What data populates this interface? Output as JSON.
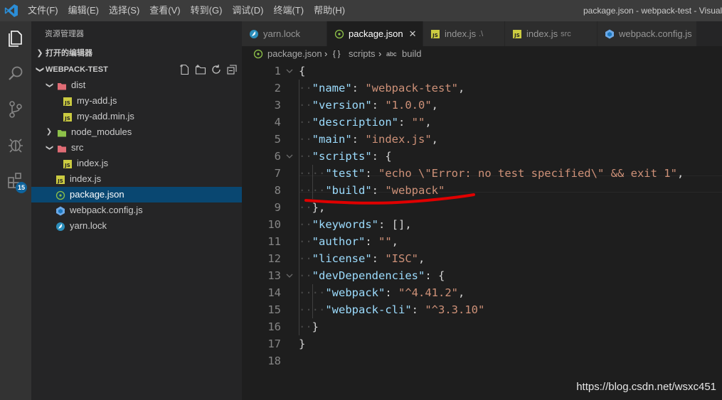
{
  "window": {
    "title": "package.json - webpack-test - Visual Studio Code",
    "menu": [
      "文件(F)",
      "编辑(E)",
      "选择(S)",
      "查看(V)",
      "转到(G)",
      "调试(D)",
      "终端(T)",
      "帮助(H)"
    ]
  },
  "activity_bar": {
    "items": [
      "files-icon",
      "search-icon",
      "source-control-icon",
      "debug-icon",
      "extensions-icon"
    ],
    "extensions_badge": "15",
    "accent": "#0e639c"
  },
  "explorer": {
    "title": "资源管理器",
    "open_editors_label": "打开的编辑器",
    "project_label": "WEBPACK-TEST",
    "tree": [
      {
        "name": "dist",
        "type": "folder",
        "expanded": true,
        "depth": 1
      },
      {
        "name": "my-add.js",
        "type": "js",
        "depth": 2
      },
      {
        "name": "my-add.min.js",
        "type": "js",
        "depth": 2
      },
      {
        "name": "node_modules",
        "type": "folder",
        "expanded": false,
        "depth": 1
      },
      {
        "name": "src",
        "type": "folder",
        "expanded": true,
        "depth": 1
      },
      {
        "name": "index.js",
        "type": "js",
        "depth": 2
      },
      {
        "name": "index.js",
        "type": "js",
        "depth": 1
      },
      {
        "name": "package.json",
        "type": "json",
        "depth": 1,
        "selected": true
      },
      {
        "name": "webpack.config.js",
        "type": "webpack",
        "depth": 1
      },
      {
        "name": "yarn.lock",
        "type": "yarn",
        "depth": 1
      }
    ]
  },
  "tabs": [
    {
      "label": "yarn.lock",
      "desc": "",
      "icon": "yarn-icon",
      "active": false
    },
    {
      "label": "package.json",
      "desc": "",
      "icon": "json-icon",
      "active": true,
      "close": "✕"
    },
    {
      "label": "index.js",
      "desc": ".\\",
      "icon": "js-icon",
      "active": false
    },
    {
      "label": "index.js",
      "desc": "src",
      "icon": "js-icon",
      "active": false
    },
    {
      "label": "webpack.config.js",
      "desc": "",
      "icon": "webpack-icon",
      "active": false
    }
  ],
  "breadcrumb": {
    "file": "package.json",
    "sep": "›",
    "scripts_symbol": "{ }",
    "scripts": "scripts",
    "build_symbol": "abc",
    "build": "build"
  },
  "code": {
    "lines": [
      {
        "n": "1",
        "fold": true,
        "tokens": [
          [
            "p",
            "{"
          ]
        ]
      },
      {
        "n": "2",
        "indent": 1,
        "tokens": [
          [
            "k",
            "\"name\""
          ],
          [
            "p",
            ": "
          ],
          [
            "s",
            "\"webpack-test\""
          ],
          [
            "p",
            ","
          ]
        ]
      },
      {
        "n": "3",
        "indent": 1,
        "tokens": [
          [
            "k",
            "\"version\""
          ],
          [
            "p",
            ": "
          ],
          [
            "s",
            "\"1.0.0\""
          ],
          [
            "p",
            ","
          ]
        ]
      },
      {
        "n": "4",
        "indent": 1,
        "tokens": [
          [
            "k",
            "\"description\""
          ],
          [
            "p",
            ": "
          ],
          [
            "s",
            "\"\""
          ],
          [
            "p",
            ","
          ]
        ]
      },
      {
        "n": "5",
        "indent": 1,
        "tokens": [
          [
            "k",
            "\"main\""
          ],
          [
            "p",
            ": "
          ],
          [
            "s",
            "\"index.js\""
          ],
          [
            "p",
            ","
          ]
        ]
      },
      {
        "n": "6",
        "indent": 1,
        "fold": true,
        "tokens": [
          [
            "k",
            "\"scripts\""
          ],
          [
            "p",
            ": {"
          ]
        ]
      },
      {
        "n": "7",
        "indent": 2,
        "tokens": [
          [
            "k",
            "\"test\""
          ],
          [
            "p",
            ": "
          ],
          [
            "s",
            "\"echo \\\"Error: no test specified\\\" && exit 1\""
          ],
          [
            "p",
            ","
          ]
        ]
      },
      {
        "n": "8",
        "indent": 2,
        "tokens": [
          [
            "k",
            "\"build\""
          ],
          [
            "p",
            ": "
          ],
          [
            "s",
            "\"webpack\""
          ]
        ]
      },
      {
        "n": "9",
        "indent": 1,
        "tokens": [
          [
            "p",
            "},"
          ]
        ]
      },
      {
        "n": "10",
        "indent": 1,
        "tokens": [
          [
            "k",
            "\"keywords\""
          ],
          [
            "p",
            ": [],"
          ]
        ]
      },
      {
        "n": "11",
        "indent": 1,
        "tokens": [
          [
            "k",
            "\"author\""
          ],
          [
            "p",
            ": "
          ],
          [
            "s",
            "\"\""
          ],
          [
            "p",
            ","
          ]
        ]
      },
      {
        "n": "12",
        "indent": 1,
        "tokens": [
          [
            "k",
            "\"license\""
          ],
          [
            "p",
            ": "
          ],
          [
            "s",
            "\"ISC\""
          ],
          [
            "p",
            ","
          ]
        ]
      },
      {
        "n": "13",
        "indent": 1,
        "fold": true,
        "tokens": [
          [
            "k",
            "\"devDependencies\""
          ],
          [
            "p",
            ": {"
          ]
        ]
      },
      {
        "n": "14",
        "indent": 2,
        "tokens": [
          [
            "k",
            "\"webpack\""
          ],
          [
            "p",
            ": "
          ],
          [
            "s",
            "\"^4.41.2\""
          ],
          [
            "p",
            ","
          ]
        ]
      },
      {
        "n": "15",
        "indent": 2,
        "tokens": [
          [
            "k",
            "\"webpack-cli\""
          ],
          [
            "p",
            ": "
          ],
          [
            "s",
            "\"^3.3.10\""
          ]
        ]
      },
      {
        "n": "16",
        "indent": 1,
        "tokens": [
          [
            "p",
            "}"
          ]
        ]
      },
      {
        "n": "17",
        "tokens": [
          [
            "p",
            "}"
          ]
        ]
      },
      {
        "n": "18",
        "tokens": []
      }
    ]
  },
  "annotation": {
    "color": "#e00000"
  },
  "watermark": "https://blog.csdn.net/wsxc451"
}
